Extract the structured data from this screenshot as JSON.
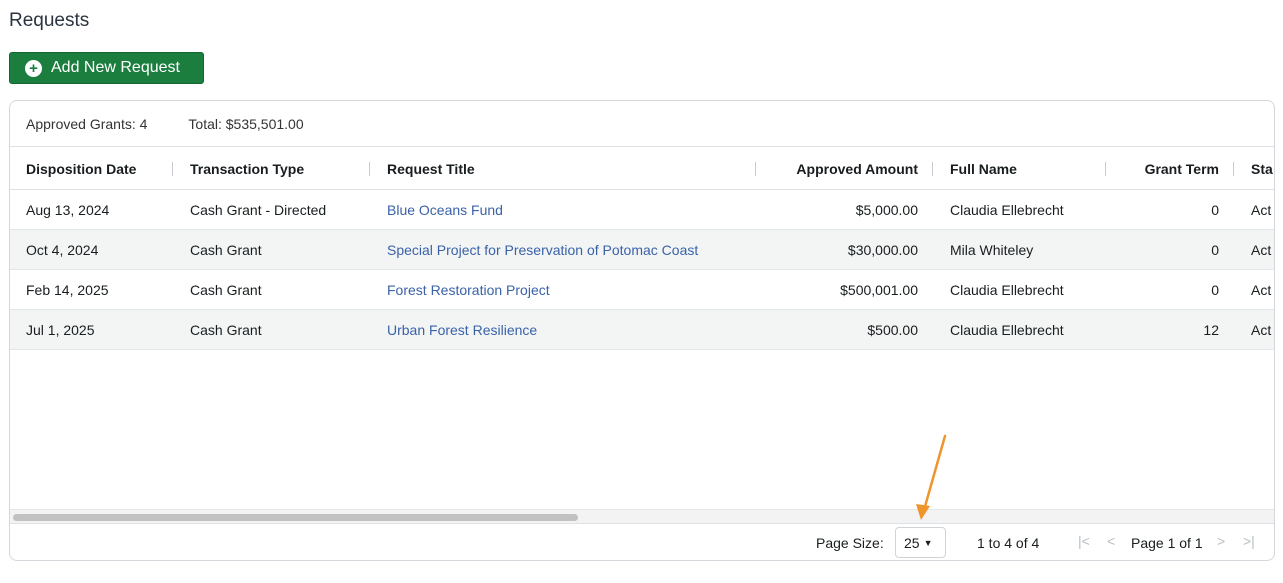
{
  "page": {
    "title": "Requests"
  },
  "toolbar": {
    "add_label": "Add New Request",
    "add_icon": "plus-circle-icon"
  },
  "summary": {
    "approved_grants": "Approved Grants: 4",
    "total": "Total: $535,501.00"
  },
  "columns": [
    "Disposition Date",
    "Transaction Type",
    "Request Title",
    "Approved Amount",
    "Full Name",
    "Grant Term",
    "Sta"
  ],
  "rows": [
    [
      "Aug 13, 2024",
      "Cash Grant - Directed",
      "Blue Oceans Fund",
      "$5,000.00",
      "Claudia Ellebrecht",
      "0",
      "Act"
    ],
    [
      "Oct 4, 2024",
      "Cash Grant",
      "Special Project for Preservation of Potomac Coast",
      "$30,000.00",
      "Mila Whiteley",
      "0",
      "Act"
    ],
    [
      "Feb 14, 2025",
      "Cash Grant",
      "Forest Restoration Project",
      "$500,001.00",
      "Claudia Ellebrecht",
      "0",
      "Act"
    ],
    [
      "Jul 1, 2025",
      "Cash Grant",
      "Urban Forest Resilience",
      "$500.00",
      "Claudia Ellebrecht",
      "12",
      "Act"
    ]
  ],
  "pager": {
    "page_size_label": "Page Size:",
    "page_size_value": "25",
    "range": "1 to 4 of 4",
    "page_info": "Page 1 of 1",
    "first_glyph": "|<",
    "prev_glyph": "<",
    "next_glyph": ">",
    "last_glyph": ">|"
  },
  "colors": {
    "accent_button": "#1b7e3f",
    "link": "#3a62a8",
    "annotation_arrow": "#f0952b"
  }
}
